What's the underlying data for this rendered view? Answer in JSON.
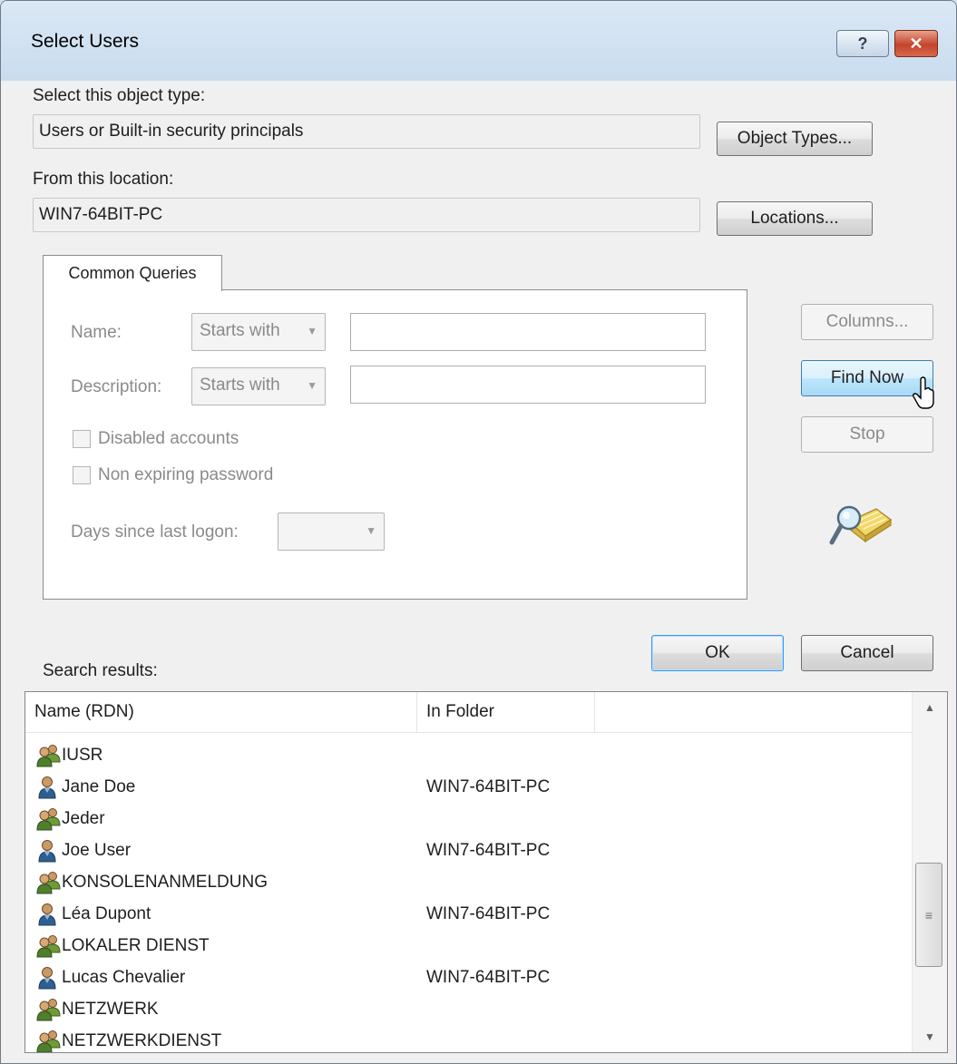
{
  "window": {
    "title": "Select Users",
    "help_glyph": "?",
    "close_glyph": "✕"
  },
  "object_type": {
    "label": "Select this object type:",
    "value": "Users or Built-in security principals",
    "button": "Object Types..."
  },
  "location": {
    "label": "From this location:",
    "value": "WIN7-64BIT-PC",
    "button": "Locations..."
  },
  "queries": {
    "tab_label": "Common Queries",
    "name_label": "Name:",
    "name_mode": "Starts with",
    "description_label": "Description:",
    "description_mode": "Starts with",
    "disabled_accounts": "Disabled accounts",
    "non_expiring_password": "Non expiring password",
    "days_since_logon_label": "Days since last logon:"
  },
  "side_buttons": {
    "columns": "Columns...",
    "find_now": "Find Now",
    "stop": "Stop"
  },
  "dialog_buttons": {
    "ok": "OK",
    "cancel": "Cancel"
  },
  "results": {
    "label": "Search results:",
    "columns": [
      "Name (RDN)",
      "In Folder"
    ],
    "rows": [
      {
        "name": "IUSR",
        "folder": "",
        "icon": "group-icon"
      },
      {
        "name": "Jane Doe",
        "folder": "WIN7-64BIT-PC",
        "icon": "user-icon"
      },
      {
        "name": "Jeder",
        "folder": "",
        "icon": "group-icon"
      },
      {
        "name": "Joe User",
        "folder": "WIN7-64BIT-PC",
        "icon": "user-icon"
      },
      {
        "name": "KONSOLENANMELDUNG",
        "folder": "",
        "icon": "group-icon"
      },
      {
        "name": "Léa Dupont",
        "folder": "WIN7-64BIT-PC",
        "icon": "user-icon"
      },
      {
        "name": "LOKALER DIENST",
        "folder": "",
        "icon": "group-icon"
      },
      {
        "name": "Lucas Chevalier",
        "folder": "WIN7-64BIT-PC",
        "icon": "user-icon"
      },
      {
        "name": "NETZWERK",
        "folder": "",
        "icon": "group-icon"
      },
      {
        "name": "NETZWERKDIENST",
        "folder": "",
        "icon": "group-icon"
      }
    ]
  },
  "colors": {
    "title_bar": "#c9dcef",
    "close_button": "#c4442b",
    "default_button_border": "#3399ff",
    "disabled_text": "#8a8a8a"
  }
}
